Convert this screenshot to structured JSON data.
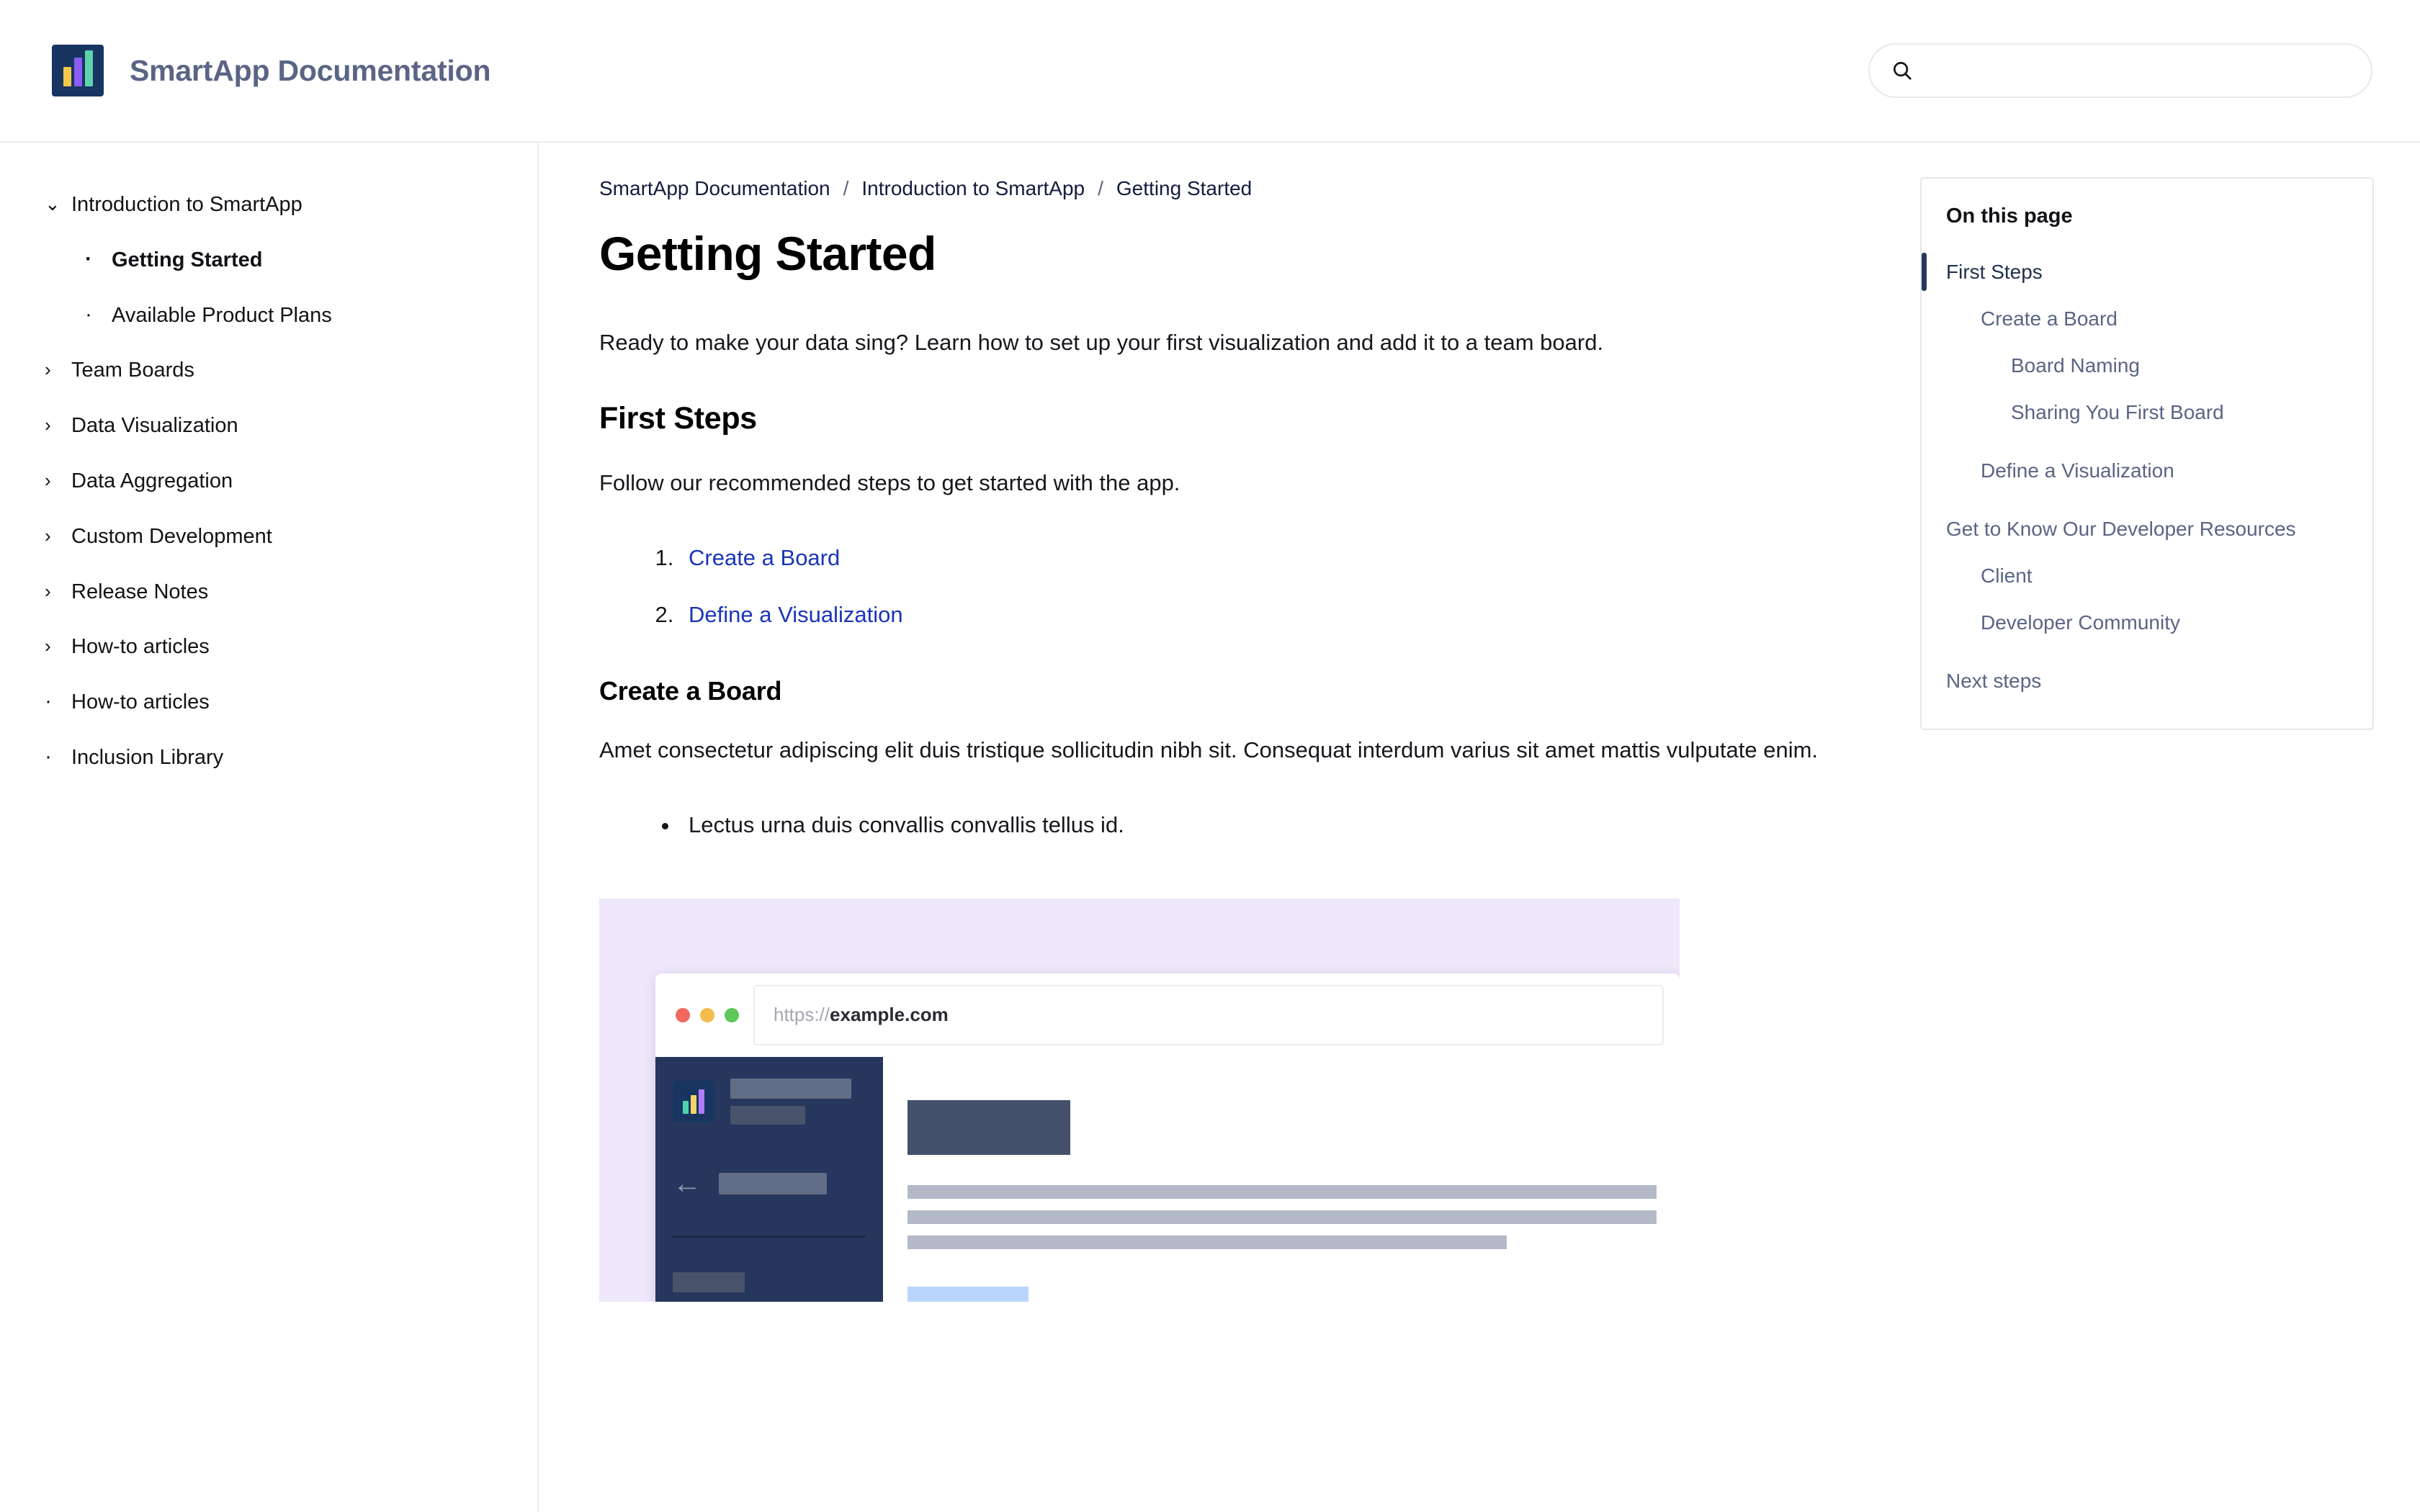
{
  "header": {
    "brand_title": "SmartApp Documentation",
    "logo_icon": "bar-chart-logo-icon",
    "logo_colors": [
      "#f2c94c",
      "#8b5cf6",
      "#5fd4ab"
    ],
    "logo_background": "#173560",
    "search": {
      "icon": "search-icon",
      "value": "",
      "placeholder": ""
    }
  },
  "sidebar": {
    "items": [
      {
        "label": "Introduction to SmartApp",
        "marker": "chevron-down-icon",
        "level": 1,
        "active": false
      },
      {
        "label": "Getting Started",
        "marker": "dot",
        "level": 2,
        "active": true
      },
      {
        "label": "Available Product Plans",
        "marker": "dot",
        "level": 2,
        "active": false
      },
      {
        "label": "Team Boards",
        "marker": "chevron-right-icon",
        "level": 1,
        "active": false
      },
      {
        "label": "Data Visualization",
        "marker": "chevron-right-icon",
        "level": 1,
        "active": false
      },
      {
        "label": "Data Aggregation",
        "marker": "chevron-right-icon",
        "level": 1,
        "active": false
      },
      {
        "label": "Custom Development",
        "marker": "chevron-right-icon",
        "level": 1,
        "active": false
      },
      {
        "label": "Release Notes",
        "marker": "chevron-right-icon",
        "level": 1,
        "active": false
      },
      {
        "label": "How-to articles",
        "marker": "chevron-right-icon",
        "level": 1,
        "active": false
      },
      {
        "label": "How-to articles",
        "marker": "dot",
        "level": 1,
        "active": false
      },
      {
        "label": "Inclusion Library",
        "marker": "dot",
        "level": 1,
        "active": false
      }
    ]
  },
  "breadcrumb": {
    "items": [
      "SmartApp Documentation",
      "Introduction to SmartApp",
      "Getting Started"
    ],
    "separator": "/"
  },
  "article": {
    "title": "Getting Started",
    "intro": "Ready to make your data sing? Learn how to set up your first visualization and add it to a team board.",
    "first_steps": {
      "heading": "First Steps",
      "paragraph": "Follow our recommended steps to get started with the app.",
      "links": [
        "Create a Board",
        "Define a Visualization"
      ]
    },
    "create_board": {
      "heading": "Create a Board",
      "paragraph": "Amet consectetur adipiscing elit duis tristique sollicitudin nibh sit. Consequat interdum varius sit amet mattis vulputate enim.",
      "bullets": [
        "Lectus urna duis convallis convallis tellus id."
      ]
    },
    "illustration": {
      "name": "app-screenshot-illustration",
      "background": "#efe8fa",
      "browser_url_scheme": "https://",
      "browser_url_host": "example.com",
      "traffic_lights": [
        "#f2685f",
        "#f3bc4e",
        "#5dc758"
      ],
      "mock_sidebar_background": "#26365c",
      "back_arrow_icon": "arrow-left-icon",
      "photo_frame_color": "#dd2b1c"
    }
  },
  "toc": {
    "title": "On this page",
    "items": [
      {
        "label": "First Steps",
        "level": 1,
        "active": true
      },
      {
        "label": "Create a Board",
        "level": 2,
        "active": false
      },
      {
        "label": "Board Naming",
        "level": 3,
        "active": false
      },
      {
        "label": "Sharing You First Board",
        "level": 3,
        "active": false
      },
      {
        "label": "Define a Visualization",
        "level": 2,
        "active": false
      },
      {
        "label": "Get to Know Our Developer Resources",
        "level": 1,
        "active": false
      },
      {
        "label": "Client",
        "level": 2,
        "active": false
      },
      {
        "label": "Developer Community",
        "level": 2,
        "active": false
      },
      {
        "label": "Next steps",
        "level": 1,
        "active": false
      }
    ]
  }
}
